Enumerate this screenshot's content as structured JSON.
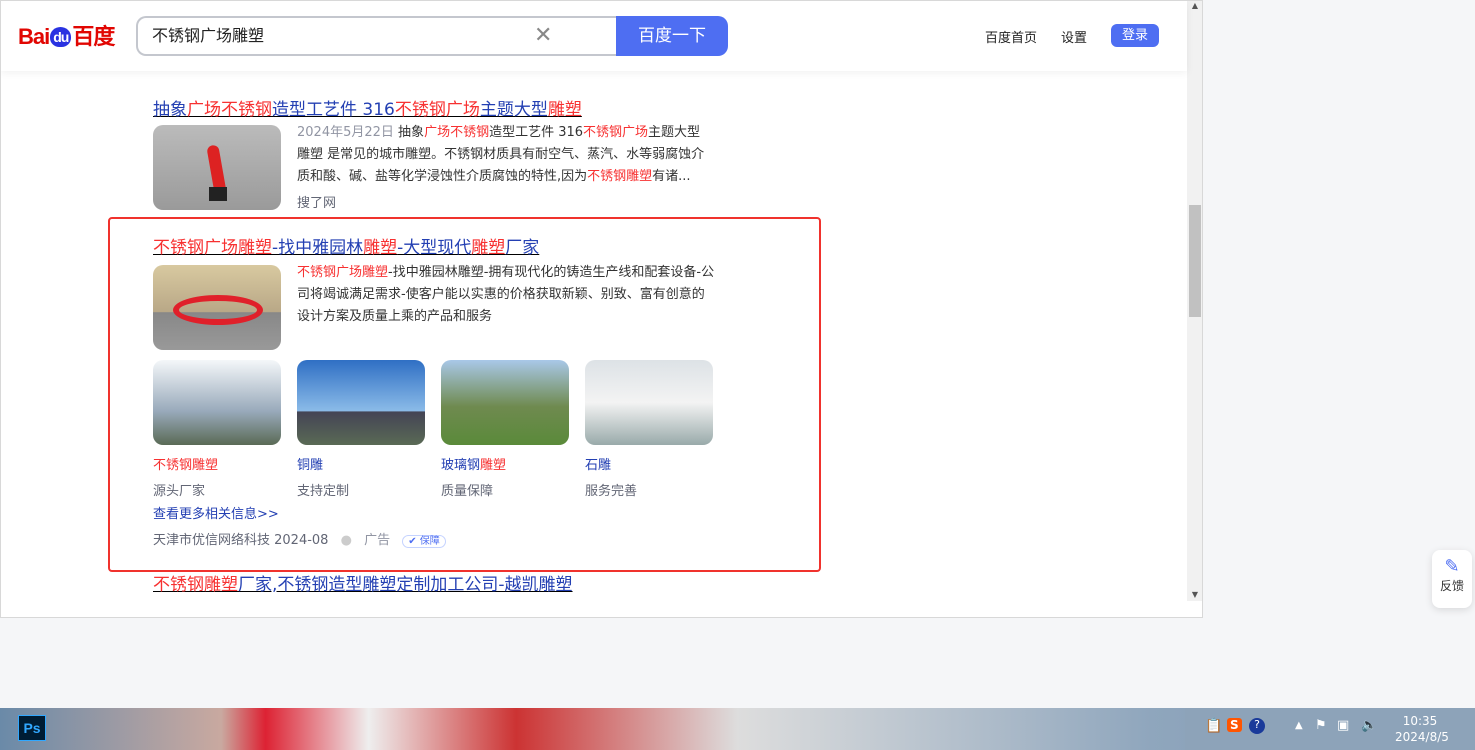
{
  "header": {
    "logo": "Baidu百度",
    "search_value": "不锈钢广场雕塑",
    "search_button": "百度一下",
    "nav": [
      "百度首页",
      "设置"
    ],
    "login": "登录"
  },
  "result1": {
    "title": [
      [
        "抽象",
        "b"
      ],
      [
        "广场不锈钢",
        "r"
      ],
      [
        "造型工艺件 316",
        "b"
      ],
      [
        "不锈钢广场",
        "r"
      ],
      [
        "主题大型",
        "b"
      ],
      [
        "雕塑",
        "r"
      ]
    ],
    "date": "2024年5月22日",
    "desc": [
      [
        "抽象",
        ""
      ],
      [
        "广场不锈钢",
        "r"
      ],
      [
        "造型工艺件 316",
        ""
      ],
      [
        "不锈钢广场",
        "r"
      ],
      [
        "主题大型雕塑 是常见的城市雕塑。不锈钢材质具有耐空气、蒸汽、水等弱腐蚀介质和酸、碱、盐等化学浸蚀性介质腐蚀的特性,因为",
        ""
      ],
      [
        "不锈钢雕塑",
        "r"
      ],
      [
        "有诸...",
        ""
      ]
    ],
    "source": "搜了网"
  },
  "ad": {
    "title": [
      [
        "不锈钢广场雕塑",
        "r"
      ],
      [
        "-找中雅园林",
        "b"
      ],
      [
        "雕塑",
        "r"
      ],
      [
        "-大型现代",
        "b"
      ],
      [
        "雕塑",
        "r"
      ],
      [
        "厂家",
        "b"
      ]
    ],
    "desc_highlight": "不锈钢广场雕塑",
    "desc": "-找中雅园林雕塑-拥有现代化的铸造生产线和配套设备-公司将竭诚满足需求-使客户能以实惠的价格获取新颖、别致、富有创意的设计方案及质量上乘的产品和服务",
    "cards": [
      {
        "title": [
          [
            "不锈钢雕塑",
            "r"
          ]
        ],
        "sub": "源头厂家"
      },
      {
        "title": [
          [
            "铜雕",
            "b"
          ]
        ],
        "sub": "支持定制"
      },
      {
        "title": [
          [
            "玻璃钢",
            "b"
          ],
          [
            "雕塑",
            "r"
          ]
        ],
        "sub": "质量保障"
      },
      {
        "title": [
          [
            "石雕",
            "b"
          ]
        ],
        "sub": "服务完善"
      }
    ],
    "more": "查看更多相关信息>>",
    "source": "天津市优信网络科技 2024-08",
    "ad_label": "广告",
    "badge": "保障"
  },
  "result3": {
    "title": [
      [
        "不锈钢雕塑",
        "r"
      ],
      [
        "厂家,不锈钢造型雕塑定制加工公司-越凯雕塑",
        "b"
      ]
    ]
  },
  "feedback": "反馈",
  "taskbar": {
    "time": "10:35",
    "date": "2024/8/5",
    "ps": "Ps"
  },
  "colors": {
    "accent": "#4e6ef2",
    "highlight": "#f73131",
    "link": "#2440b3",
    "ad_border": "#f0322d"
  }
}
